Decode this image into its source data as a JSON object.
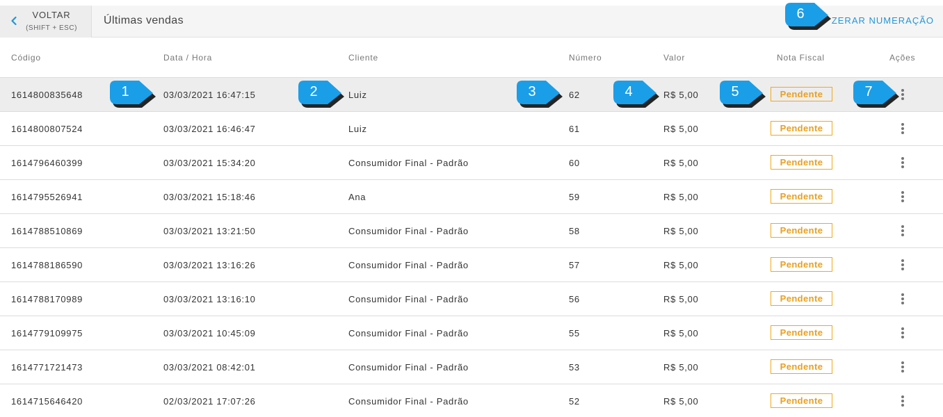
{
  "header": {
    "back_label": "VOLTAR",
    "back_hint": "(SHIFT + ESC)",
    "title": "Últimas vendas",
    "reset_label": "ZERAR NUMERAÇÃO",
    "accent_color": "#2196d6"
  },
  "table": {
    "columns": [
      "Código",
      "Data / Hora",
      "Cliente",
      "Número",
      "Valor",
      "Nota Fiscal",
      "Ações"
    ],
    "rows": [
      {
        "codigo": "1614800835648",
        "data_hora": "03/03/2021 16:47:15",
        "cliente": "Luiz",
        "numero": "62",
        "valor": "R$ 5,00",
        "nota": "Pendente"
      },
      {
        "codigo": "1614800807524",
        "data_hora": "03/03/2021 16:46:47",
        "cliente": "Luiz",
        "numero": "61",
        "valor": "R$ 5,00",
        "nota": "Pendente"
      },
      {
        "codigo": "1614796460399",
        "data_hora": "03/03/2021 15:34:20",
        "cliente": "Consumidor Final - Padrão",
        "numero": "60",
        "valor": "R$ 5,00",
        "nota": "Pendente"
      },
      {
        "codigo": "1614795526941",
        "data_hora": "03/03/2021 15:18:46",
        "cliente": "Ana",
        "numero": "59",
        "valor": "R$ 5,00",
        "nota": "Pendente"
      },
      {
        "codigo": "1614788510869",
        "data_hora": "03/03/2021 13:21:50",
        "cliente": "Consumidor Final - Padrão",
        "numero": "58",
        "valor": "R$ 5,00",
        "nota": "Pendente"
      },
      {
        "codigo": "1614788186590",
        "data_hora": "03/03/2021 13:16:26",
        "cliente": "Consumidor Final - Padrão",
        "numero": "57",
        "valor": "R$ 5,00",
        "nota": "Pendente"
      },
      {
        "codigo": "1614788170989",
        "data_hora": "03/03/2021 13:16:10",
        "cliente": "Consumidor Final - Padrão",
        "numero": "56",
        "valor": "R$ 5,00",
        "nota": "Pendente"
      },
      {
        "codigo": "1614779109975",
        "data_hora": "03/03/2021 10:45:09",
        "cliente": "Consumidor Final - Padrão",
        "numero": "55",
        "valor": "R$ 5,00",
        "nota": "Pendente"
      },
      {
        "codigo": "1614771721473",
        "data_hora": "03/03/2021 08:42:01",
        "cliente": "Consumidor Final - Padrão",
        "numero": "53",
        "valor": "R$ 5,00",
        "nota": "Pendente"
      },
      {
        "codigo": "1614715646420",
        "data_hora": "02/03/2021 17:07:26",
        "cliente": "Consumidor Final - Padrão",
        "numero": "52",
        "valor": "R$ 5,00",
        "nota": "Pendente"
      }
    ],
    "pending_color": "#f0a81b"
  },
  "callouts": [
    "1",
    "2",
    "3",
    "4",
    "5",
    "6",
    "7"
  ],
  "callout_color": "#1a9ee8"
}
